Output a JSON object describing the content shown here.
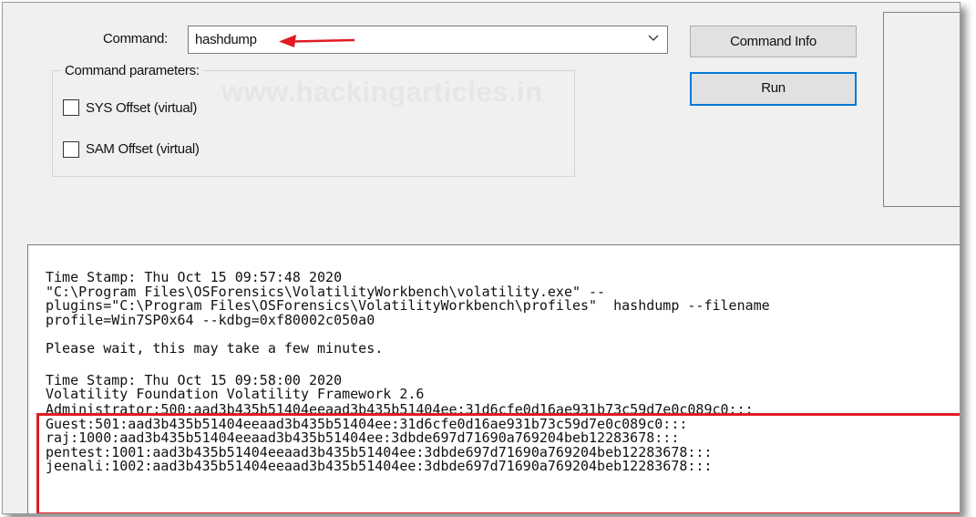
{
  "command": {
    "label": "Command:",
    "value": "hashdump"
  },
  "buttons": {
    "command_info": "Command Info",
    "run": "Run"
  },
  "params": {
    "title": "Command parameters:",
    "sys_offset": "SYS Offset (virtual)",
    "sam_offset": "SAM Offset (virtual)",
    "sys_checked": false,
    "sam_checked": false
  },
  "watermark": "www.hackingarticles.in",
  "output": {
    "block1": [
      "Time Stamp: Thu Oct 15 09:57:48 2020",
      "\"C:\\Program Files\\OSForensics\\VolatilityWorkbench\\volatility.exe\" --",
      "plugins=\"C:\\Program Files\\OSForensics\\VolatilityWorkbench\\profiles\"  hashdump --filename",
      "profile=Win7SP0x64 --kdbg=0xf80002c050a0"
    ],
    "wait": "Please wait, this may take a few minutes.",
    "block2": [
      "Time Stamp: Thu Oct 15 09:58:00 2020",
      "Volatility Foundation Volatility Framework 2.6"
    ],
    "hashes": [
      "Administrator:500:aad3b435b51404eeaad3b435b51404ee:31d6cfe0d16ae931b73c59d7e0c089c0:::",
      "Guest:501:aad3b435b51404eeaad3b435b51404ee:31d6cfe0d16ae931b73c59d7e0c089c0:::",
      "raj:1000:aad3b435b51404eeaad3b435b51404ee:3dbde697d71690a769204beb12283678:::",
      "pentest:1001:aad3b435b51404eeaad3b435b51404ee:3dbde697d71690a769204beb12283678:::",
      "jeenali:1002:aad3b435b51404eeaad3b435b51404ee:3dbde697d71690a769204beb12283678:::"
    ]
  },
  "colors": {
    "annotation_red": "#e01b24",
    "default_button_border": "#0078d7"
  }
}
